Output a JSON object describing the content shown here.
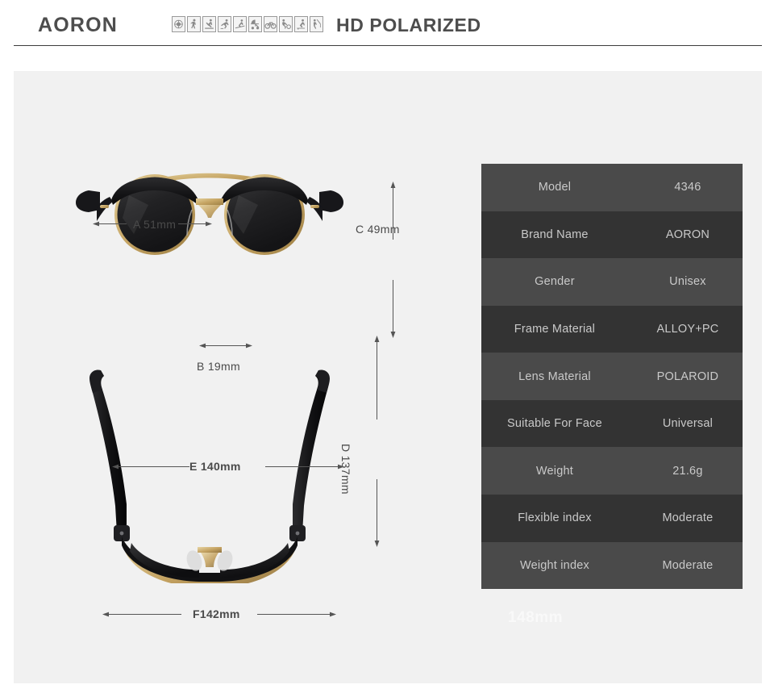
{
  "header": {
    "brand": "AORON",
    "title": "HD POLARIZED",
    "icons": [
      "sun-icon",
      "walking-icon",
      "golf-icon",
      "running-icon",
      "skiing-icon",
      "stroller-icon",
      "cycling-icon",
      "soccer-icon",
      "skating-icon",
      "fishing-icon"
    ]
  },
  "dimensions": {
    "a": "A 51mm",
    "b": "B 19mm",
    "c": "C 49mm",
    "d": "D 137mm",
    "e": "E 140mm",
    "f": "F142mm"
  },
  "watermark": "148mm",
  "spec_table": {
    "rows": [
      {
        "key": "Model",
        "value": "4346"
      },
      {
        "key": "Brand Name",
        "value": "AORON"
      },
      {
        "key": "Gender",
        "value": "Unisex"
      },
      {
        "key": "Frame Material",
        "value": "ALLOY+PC"
      },
      {
        "key": "Lens Material",
        "value": "POLAROID"
      },
      {
        "key": "Suitable For Face",
        "value": "Universal"
      },
      {
        "key": "Weight",
        "value": "21.6g"
      },
      {
        "key": "Flexible index",
        "value": "Moderate"
      },
      {
        "key": "Weight index",
        "value": "Moderate"
      }
    ]
  },
  "colors": {
    "page_background": "#ffffff",
    "panel_background": "#f1f1f1",
    "header_text": "#4d4d4d",
    "rule": "#3c3c3c",
    "row_odd": "#4a4a4a",
    "row_even": "#333333",
    "table_text": "#c9c9c9",
    "dimension_text": "#4a4a4a",
    "frame_black": "#121212",
    "frame_gold": "#c9a961"
  }
}
